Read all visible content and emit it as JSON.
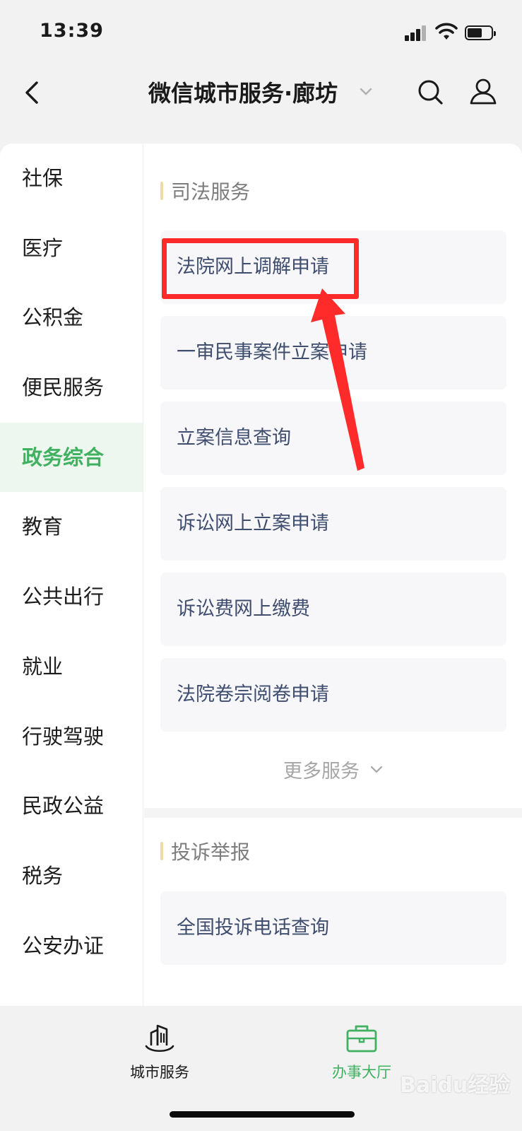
{
  "status_bar": {
    "time": "13:39"
  },
  "nav": {
    "title": "微信城市服务·廊坊"
  },
  "sidebar": {
    "items": [
      {
        "label": "社保"
      },
      {
        "label": "医疗"
      },
      {
        "label": "公积金"
      },
      {
        "label": "便民服务"
      },
      {
        "label": "政务综合",
        "active": true
      },
      {
        "label": "教育"
      },
      {
        "label": "公共出行"
      },
      {
        "label": "就业"
      },
      {
        "label": "行驶驾驶"
      },
      {
        "label": "民政公益"
      },
      {
        "label": "税务"
      },
      {
        "label": "公安办证"
      }
    ]
  },
  "sections": [
    {
      "title": "司法服务",
      "services": [
        {
          "label": "法院网上调解申请"
        },
        {
          "label": "一审民事案件立案申请"
        },
        {
          "label": "立案信息查询"
        },
        {
          "label": "诉讼网上立案申请"
        },
        {
          "label": "诉讼费网上缴费"
        },
        {
          "label": "法院卷宗阅卷申请"
        }
      ],
      "more_label": "更多服务"
    },
    {
      "title": "投诉举报",
      "services": [
        {
          "label": "全国投诉电话查询"
        }
      ]
    }
  ],
  "tab_bar": {
    "tabs": [
      {
        "label": "城市服务",
        "icon": "city-building-icon",
        "active": false
      },
      {
        "label": "办事大厅",
        "icon": "briefcase-icon",
        "active": true
      }
    ]
  },
  "watermark": {
    "text": "Baidu经验"
  },
  "colors": {
    "accent_green": "#3fb160",
    "annotation_red": "#ff2a2a",
    "service_text": "#3f4d6e",
    "section_bar": "#f0d9a8"
  }
}
